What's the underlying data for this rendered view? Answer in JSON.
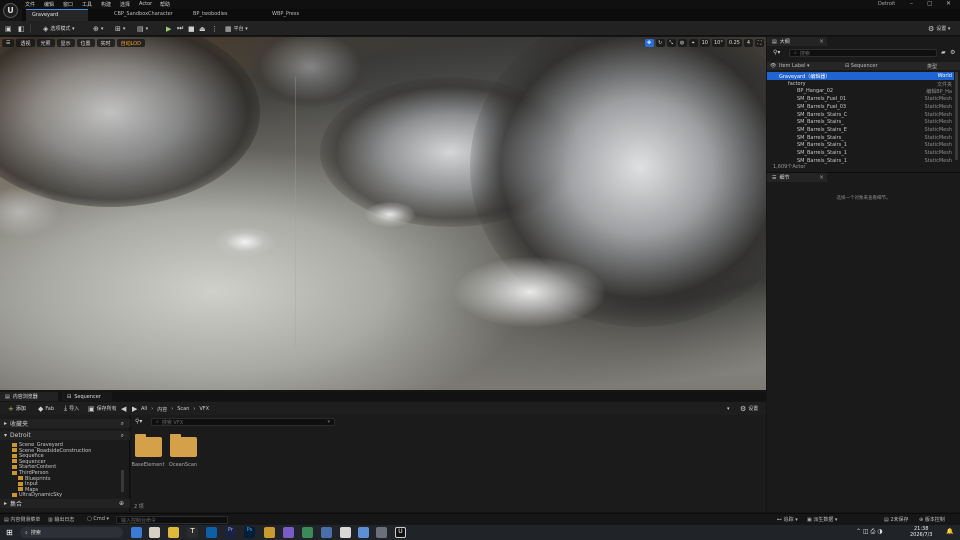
{
  "app": {
    "project_name": "Detroit",
    "menu": [
      "文件",
      "编辑",
      "窗口",
      "工具",
      "构建",
      "选择",
      "Actor",
      "帮助"
    ],
    "tabs": [
      {
        "label": "Graveyard",
        "active": true
      },
      {
        "label": "CBP_SandboxCharacter",
        "active": false
      },
      {
        "label": "BP_twobodies",
        "active": false
      },
      {
        "label": "WBP_Press",
        "active": false
      }
    ]
  },
  "toolbar": {
    "mode_label": "选项模式",
    "platform_label": "平台",
    "settings_label": "设置"
  },
  "viewport": {
    "left_chips": [
      "透视",
      "光照",
      "显示",
      "位置"
    ],
    "realtime_label": "实时",
    "lod_label": "自动LOD",
    "right_values": [
      "10",
      "10°",
      "0.25",
      "4"
    ]
  },
  "outliner": {
    "tab_label": "大纲",
    "search_placeholder": "搜索",
    "col_label": "Item Label",
    "col_sequencer": "Sequencer",
    "col_type": "类型",
    "rows": [
      {
        "name": "Graveyard（编辑器）",
        "type": "World",
        "indent": 0,
        "selected": true
      },
      {
        "name": "factory",
        "type": "文件夹",
        "indent": 1,
        "selected": false
      },
      {
        "name": "BP_Hangar_02",
        "type": "编辑BP_Ha",
        "indent": 2,
        "selected": false
      },
      {
        "name": "SM_Barrels_Fuel_01",
        "type": "StaticMesh",
        "indent": 2,
        "selected": false
      },
      {
        "name": "SM_Barrels_Fuel_03",
        "type": "StaticMesh",
        "indent": 2,
        "selected": false
      },
      {
        "name": "SM_Barrels_Stairs_C",
        "type": "StaticMesh",
        "indent": 2,
        "selected": false
      },
      {
        "name": "SM_Barrels_Stairs_",
        "type": "StaticMesh",
        "indent": 2,
        "selected": false
      },
      {
        "name": "SM_Barrels_Stairs_E",
        "type": "StaticMesh",
        "indent": 2,
        "selected": false
      },
      {
        "name": "SM_Barrels_Stairs_",
        "type": "StaticMesh",
        "indent": 2,
        "selected": false
      },
      {
        "name": "SM_Barrels_Stairs_1",
        "type": "StaticMesh",
        "indent": 2,
        "selected": false
      },
      {
        "name": "SM_Barrels_Stairs_1",
        "type": "StaticMesh",
        "indent": 2,
        "selected": false
      },
      {
        "name": "SM_Barrels_Stairs_1",
        "type": "StaticMesh",
        "indent": 2,
        "selected": false
      }
    ],
    "actor_count": "1,609个Actor"
  },
  "details": {
    "tab_label": "细节",
    "empty_text": "选择一个对象来查看细节。"
  },
  "content_browser": {
    "tab_label": "内容浏览器",
    "sequencer_tab": "Sequencer",
    "add_label": "添加",
    "fab_label": "Fab",
    "import_label": "导入",
    "save_all_label": "保存所有",
    "path": [
      "All",
      "内容",
      "Scan",
      "VFX"
    ],
    "settings_label": "设置",
    "search_placeholder": "搜索 VFX",
    "favorites_label": "收藏夹",
    "root_label": "Detroit",
    "tree": [
      {
        "label": "Scene_Graveyard",
        "indent": 1
      },
      {
        "label": "Scene_RoadsideConstruction",
        "indent": 1
      },
      {
        "label": "Sequence",
        "indent": 1
      },
      {
        "label": "Sequencer",
        "indent": 1
      },
      {
        "label": "StarterContent",
        "indent": 1
      },
      {
        "label": "ThirdPerson",
        "indent": 1
      },
      {
        "label": "Blueprints",
        "indent": 2
      },
      {
        "label": "Input",
        "indent": 2
      },
      {
        "label": "Maps",
        "indent": 2
      },
      {
        "label": "UltraDynamicSky",
        "indent": 1
      }
    ],
    "collections_label": "集合",
    "folders": [
      {
        "label": "BaseElement"
      },
      {
        "label": "OceanScan"
      }
    ],
    "item_count": "2 项"
  },
  "status_bar": {
    "drawer_label": "内容侧滑菜单",
    "output_log_label": "输出日志",
    "cmd_label": "Cmd",
    "cmd_placeholder": "输入控制台命令",
    "trace_label": "追踪",
    "derived_data_label": "派生数据",
    "unsaved_label": "2未保存",
    "source_control_label": "版本控制"
  },
  "taskbar": {
    "search_placeholder": "搜索",
    "time": "21:38",
    "date": "2026/7/3"
  },
  "colors": {
    "accent": "#1f64d0",
    "folder": "#d4a04a"
  }
}
